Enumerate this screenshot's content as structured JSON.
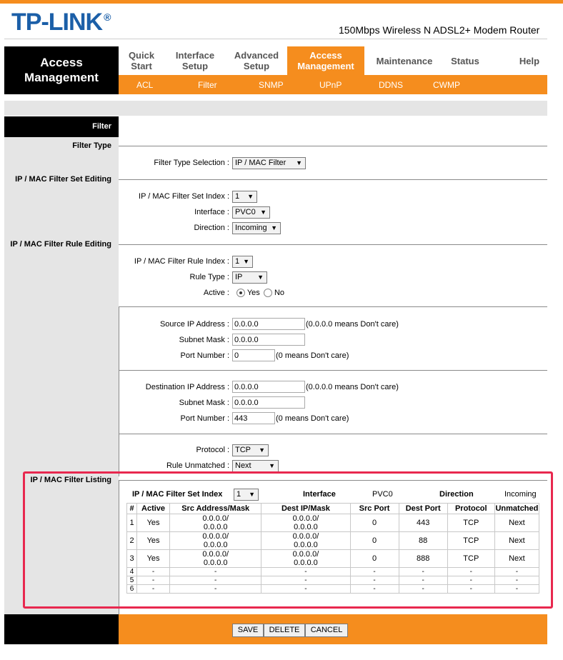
{
  "brand": {
    "logo": "TP-LINK",
    "reg": "®",
    "model": "150Mbps Wireless N ADSL2+ Modem Router"
  },
  "nav": {
    "section_title_1": "Access",
    "section_title_2": "Management",
    "items": [
      {
        "line1": "Quick",
        "line2": "Start"
      },
      {
        "line1": "Interface",
        "line2": "Setup"
      },
      {
        "line1": "Advanced",
        "line2": "Setup"
      },
      {
        "line1": "Access",
        "line2": "Management"
      },
      {
        "line1": "Maintenance",
        "line2": ""
      },
      {
        "line1": "Status",
        "line2": ""
      },
      {
        "line1": "Help",
        "line2": ""
      }
    ],
    "subitems": [
      "ACL",
      "Filter",
      "SNMP",
      "UPnP",
      "DDNS",
      "CWMP"
    ]
  },
  "page": {
    "header": "Filter",
    "filter_type": {
      "section": "Filter Type",
      "label": "Filter Type Selection :",
      "value": "IP / MAC Filter"
    },
    "set_editing": {
      "section": "IP / MAC Filter Set Editing",
      "index_label": "IP / MAC Filter Set Index :",
      "index_value": "1",
      "interface_label": "Interface :",
      "interface_value": "PVC0",
      "direction_label": "Direction :",
      "direction_value": "Incoming"
    },
    "rule_editing": {
      "section": "IP / MAC Filter Rule Editing",
      "index_label": "IP / MAC Filter Rule Index :",
      "index_value": "1",
      "rule_type_label": "Rule Type :",
      "rule_type_value": "IP",
      "active_label": "Active :",
      "yes": "Yes",
      "no": "No",
      "src_ip_label": "Source IP Address :",
      "src_ip_value": "0.0.0.0",
      "src_ip_hint": "(0.0.0.0 means Don't care)",
      "src_mask_label": "Subnet Mask :",
      "src_mask_value": "0.0.0.0",
      "src_port_label": "Port Number :",
      "src_port_value": "0",
      "src_port_hint": "(0 means Don't care)",
      "dst_ip_label": "Destination IP Address :",
      "dst_ip_value": "0.0.0.0",
      "dst_ip_hint": "(0.0.0.0 means Don't care)",
      "dst_mask_label": "Subnet Mask :",
      "dst_mask_value": "0.0.0.0",
      "dst_port_label": "Port Number :",
      "dst_port_value": "443",
      "dst_port_hint": "(0 means Don't care)",
      "protocol_label": "Protocol :",
      "protocol_value": "TCP",
      "unmatched_label": "Rule Unmatched :",
      "unmatched_value": "Next"
    },
    "listing": {
      "section": "IP / MAC Filter Listing",
      "set_index_label": "IP / MAC Filter Set Index",
      "set_index_value": "1",
      "interface_label": "Interface",
      "interface_value": "PVC0",
      "direction_label": "Direction",
      "direction_value": "Incoming",
      "columns": [
        "#",
        "Active",
        "Src Address/Mask",
        "Dest IP/Mask",
        "Src Port",
        "Dest Port",
        "Protocol",
        "Unmatched"
      ],
      "rows": [
        [
          "1",
          "Yes",
          "0.0.0.0/",
          "0.0.0.0",
          "0.0.0.0/",
          "0.0.0.0",
          "0",
          "443",
          "TCP",
          "Next"
        ],
        [
          "2",
          "Yes",
          "0.0.0.0/",
          "0.0.0.0",
          "0.0.0.0/",
          "0.0.0.0",
          "0",
          "88",
          "TCP",
          "Next"
        ],
        [
          "3",
          "Yes",
          "0.0.0.0/",
          "0.0.0.0",
          "0.0.0.0/",
          "0.0.0.0",
          "0",
          "888",
          "TCP",
          "Next"
        ],
        [
          "4",
          "-",
          "-",
          "",
          "-",
          "",
          "-",
          "-",
          "-",
          "-"
        ],
        [
          "5",
          "-",
          "-",
          "",
          "-",
          "",
          "-",
          "-",
          "-",
          "-"
        ],
        [
          "6",
          "-",
          "-",
          "",
          "-",
          "",
          "-",
          "-",
          "-",
          "-"
        ]
      ]
    },
    "buttons": {
      "save": "SAVE",
      "delete": "DELETE",
      "cancel": "CANCEL"
    }
  },
  "colors": {
    "accent": "#f58d1e",
    "logo": "#1b5fa8",
    "highlight": "#e8284f"
  }
}
